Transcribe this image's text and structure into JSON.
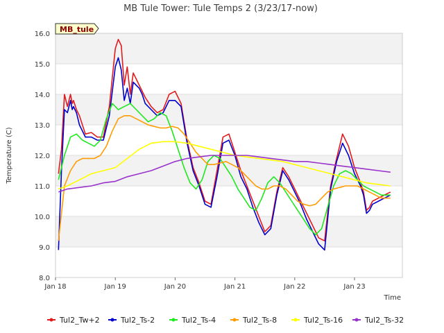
{
  "chart_data": {
    "type": "line",
    "title": "MB Tule Tower: Tule Temps 2 (3/23/17-now)",
    "xlabel": "Time",
    "ylabel": "Temperature (C)",
    "ylim": [
      8.0,
      16.0
    ],
    "xlim": [
      0,
      5.8
    ],
    "yticks": [
      "8.0",
      "9.0",
      "10.0",
      "11.0",
      "12.0",
      "13.0",
      "14.0",
      "15.0",
      "16.0"
    ],
    "xticks": [
      {
        "pos": 0,
        "label": "Jan 18"
      },
      {
        "pos": 1,
        "label": "Jan 19"
      },
      {
        "pos": 2,
        "label": "Jan 20"
      },
      {
        "pos": 3,
        "label": "Jan 21"
      },
      {
        "pos": 4,
        "label": "Jan 22"
      },
      {
        "pos": 5,
        "label": "Jan 23"
      }
    ],
    "grid": true,
    "legend_position": "bottom",
    "site_badge": "MB_tule",
    "series": [
      {
        "name": "Tul2_Tw+2",
        "color": "#e31a1c",
        "x": [
          0.05,
          0.1,
          0.15,
          0.2,
          0.25,
          0.28,
          0.3,
          0.35,
          0.4,
          0.5,
          0.6,
          0.7,
          0.8,
          0.9,
          1.0,
          1.05,
          1.1,
          1.15,
          1.2,
          1.25,
          1.3,
          1.35,
          1.4,
          1.45,
          1.5,
          1.6,
          1.7,
          1.8,
          1.9,
          2.0,
          2.1,
          2.2,
          2.3,
          2.4,
          2.5,
          2.6,
          2.7,
          2.8,
          2.9,
          3.0,
          3.1,
          3.2,
          3.3,
          3.4,
          3.5,
          3.6,
          3.7,
          3.8,
          3.9,
          4.0,
          4.1,
          4.2,
          4.3,
          4.4,
          4.5,
          4.6,
          4.7,
          4.8,
          4.9,
          5.0,
          5.1,
          5.15,
          5.2,
          5.25,
          5.3,
          5.4,
          5.5,
          5.6
        ],
        "values": [
          11.4,
          12.2,
          14.0,
          13.6,
          14.0,
          13.7,
          13.8,
          13.5,
          13.3,
          12.7,
          12.75,
          12.6,
          12.6,
          13.6,
          15.5,
          15.8,
          15.6,
          14.3,
          14.9,
          14.0,
          14.7,
          14.5,
          14.3,
          14.1,
          13.9,
          13.6,
          13.4,
          13.5,
          14.0,
          14.1,
          13.7,
          12.5,
          11.6,
          11.1,
          10.5,
          10.4,
          11.5,
          12.6,
          12.7,
          12.1,
          11.5,
          11.0,
          10.5,
          10.0,
          9.5,
          9.7,
          10.8,
          11.6,
          11.3,
          10.9,
          10.5,
          10.1,
          9.7,
          9.3,
          9.2,
          11.0,
          11.9,
          12.7,
          12.3,
          11.6,
          11.1,
          10.8,
          10.2,
          10.3,
          10.5,
          10.6,
          10.7,
          10.8
        ]
      },
      {
        "name": "Tul2_Ts-2",
        "color": "#0000cc",
        "x": [
          0.05,
          0.1,
          0.15,
          0.2,
          0.25,
          0.28,
          0.3,
          0.35,
          0.4,
          0.5,
          0.6,
          0.7,
          0.8,
          0.9,
          1.0,
          1.05,
          1.1,
          1.15,
          1.2,
          1.25,
          1.3,
          1.35,
          1.4,
          1.45,
          1.5,
          1.6,
          1.7,
          1.8,
          1.9,
          2.0,
          2.1,
          2.2,
          2.3,
          2.4,
          2.5,
          2.6,
          2.7,
          2.8,
          2.9,
          3.0,
          3.1,
          3.2,
          3.3,
          3.4,
          3.5,
          3.6,
          3.7,
          3.8,
          3.9,
          4.0,
          4.1,
          4.2,
          4.3,
          4.4,
          4.5,
          4.6,
          4.7,
          4.8,
          4.9,
          5.0,
          5.1,
          5.15,
          5.2,
          5.25,
          5.3,
          5.4,
          5.5,
          5.6
        ],
        "values": [
          8.9,
          11.5,
          13.5,
          13.4,
          13.8,
          13.5,
          13.6,
          13.4,
          13.0,
          12.6,
          12.6,
          12.5,
          12.5,
          13.3,
          14.9,
          15.2,
          14.8,
          13.8,
          14.2,
          13.7,
          14.4,
          14.3,
          14.2,
          14.0,
          13.7,
          13.5,
          13.3,
          13.4,
          13.8,
          13.8,
          13.6,
          12.4,
          11.5,
          11.0,
          10.4,
          10.3,
          11.3,
          12.4,
          12.5,
          12.0,
          11.3,
          10.9,
          10.3,
          9.8,
          9.4,
          9.6,
          10.7,
          11.5,
          11.2,
          10.8,
          10.4,
          9.9,
          9.5,
          9.1,
          8.9,
          10.9,
          11.8,
          12.4,
          12.0,
          11.4,
          11.0,
          10.7,
          10.1,
          10.2,
          10.4,
          10.5,
          10.6,
          10.7
        ]
      },
      {
        "name": "Tul2_Ts-4",
        "color": "#1ee81e",
        "x": [
          0.05,
          0.15,
          0.25,
          0.35,
          0.45,
          0.55,
          0.65,
          0.75,
          0.85,
          0.95,
          1.05,
          1.15,
          1.25,
          1.35,
          1.45,
          1.55,
          1.65,
          1.75,
          1.85,
          1.95,
          2.05,
          2.15,
          2.25,
          2.35,
          2.45,
          2.55,
          2.65,
          2.75,
          2.85,
          2.95,
          3.05,
          3.15,
          3.25,
          3.35,
          3.45,
          3.55,
          3.65,
          3.75,
          3.85,
          3.95,
          4.05,
          4.15,
          4.25,
          4.35,
          4.45,
          4.55,
          4.65,
          4.75,
          4.85,
          4.95,
          5.05,
          5.15,
          5.25,
          5.35,
          5.45,
          5.55,
          5.6
        ],
        "values": [
          11.2,
          12.0,
          12.6,
          12.7,
          12.5,
          12.4,
          12.3,
          12.5,
          13.2,
          13.7,
          13.5,
          13.6,
          13.7,
          13.5,
          13.3,
          13.1,
          13.2,
          13.4,
          13.3,
          12.8,
          12.2,
          11.6,
          11.1,
          10.9,
          11.2,
          11.8,
          12.0,
          11.9,
          11.6,
          11.3,
          10.9,
          10.6,
          10.3,
          10.2,
          10.6,
          11.1,
          11.3,
          11.1,
          10.8,
          10.5,
          10.2,
          9.9,
          9.6,
          9.4,
          9.6,
          10.3,
          11.0,
          11.4,
          11.5,
          11.4,
          11.2,
          11.0,
          10.9,
          10.8,
          10.7,
          10.7,
          10.7
        ]
      },
      {
        "name": "Tul2_Ts-8",
        "color": "#ff9c00",
        "x": [
          0.05,
          0.15,
          0.25,
          0.35,
          0.45,
          0.55,
          0.65,
          0.75,
          0.85,
          0.95,
          1.05,
          1.15,
          1.25,
          1.35,
          1.45,
          1.55,
          1.65,
          1.75,
          1.85,
          1.95,
          2.05,
          2.15,
          2.25,
          2.35,
          2.45,
          2.55,
          2.65,
          2.75,
          2.85,
          2.95,
          3.05,
          3.15,
          3.25,
          3.35,
          3.45,
          3.55,
          3.65,
          3.75,
          3.85,
          3.95,
          4.05,
          4.15,
          4.25,
          4.35,
          4.45,
          4.55,
          4.65,
          4.75,
          4.85,
          4.95,
          5.05,
          5.15,
          5.25,
          5.35,
          5.45,
          5.55,
          5.6
        ],
        "values": [
          9.2,
          11.0,
          11.5,
          11.8,
          11.9,
          11.9,
          11.9,
          12.0,
          12.3,
          12.8,
          13.2,
          13.3,
          13.3,
          13.2,
          13.1,
          13.0,
          12.95,
          12.9,
          12.9,
          12.95,
          12.9,
          12.7,
          12.4,
          12.1,
          11.9,
          11.7,
          11.7,
          11.75,
          11.8,
          11.7,
          11.6,
          11.4,
          11.2,
          11.0,
          10.9,
          10.9,
          11.0,
          11.0,
          10.9,
          10.7,
          10.5,
          10.4,
          10.35,
          10.4,
          10.6,
          10.8,
          10.9,
          10.95,
          11.0,
          11.0,
          11.0,
          10.9,
          10.8,
          10.7,
          10.6,
          10.6,
          10.6
        ]
      },
      {
        "name": "Tul2_Ts-16",
        "color": "#ffff00",
        "x": [
          0.05,
          0.2,
          0.4,
          0.6,
          0.8,
          1.0,
          1.2,
          1.4,
          1.6,
          1.8,
          2.0,
          2.2,
          2.4,
          2.6,
          2.8,
          3.0,
          3.2,
          3.4,
          3.6,
          3.8,
          4.0,
          4.2,
          4.4,
          4.6,
          4.8,
          5.0,
          5.2,
          5.4,
          5.6
        ],
        "values": [
          10.9,
          11.0,
          11.2,
          11.4,
          11.5,
          11.6,
          11.9,
          12.2,
          12.4,
          12.45,
          12.45,
          12.4,
          12.3,
          12.2,
          12.1,
          12.0,
          11.95,
          11.9,
          11.85,
          11.8,
          11.7,
          11.6,
          11.5,
          11.4,
          11.3,
          11.2,
          11.1,
          11.05,
          11.0
        ]
      },
      {
        "name": "Tul2_Ts-32",
        "color": "#9932cc",
        "x": [
          0.05,
          0.2,
          0.4,
          0.6,
          0.8,
          1.0,
          1.2,
          1.4,
          1.6,
          1.8,
          2.0,
          2.2,
          2.4,
          2.6,
          2.8,
          3.0,
          3.2,
          3.4,
          3.6,
          3.8,
          4.0,
          4.2,
          4.4,
          4.6,
          4.8,
          5.0,
          5.2,
          5.4,
          5.6
        ],
        "values": [
          10.8,
          10.9,
          10.95,
          11.0,
          11.1,
          11.15,
          11.3,
          11.4,
          11.5,
          11.65,
          11.8,
          11.9,
          11.95,
          12.0,
          12.0,
          12.0,
          12.0,
          11.95,
          11.9,
          11.85,
          11.8,
          11.8,
          11.75,
          11.7,
          11.65,
          11.6,
          11.55,
          11.5,
          11.45
        ]
      }
    ]
  }
}
